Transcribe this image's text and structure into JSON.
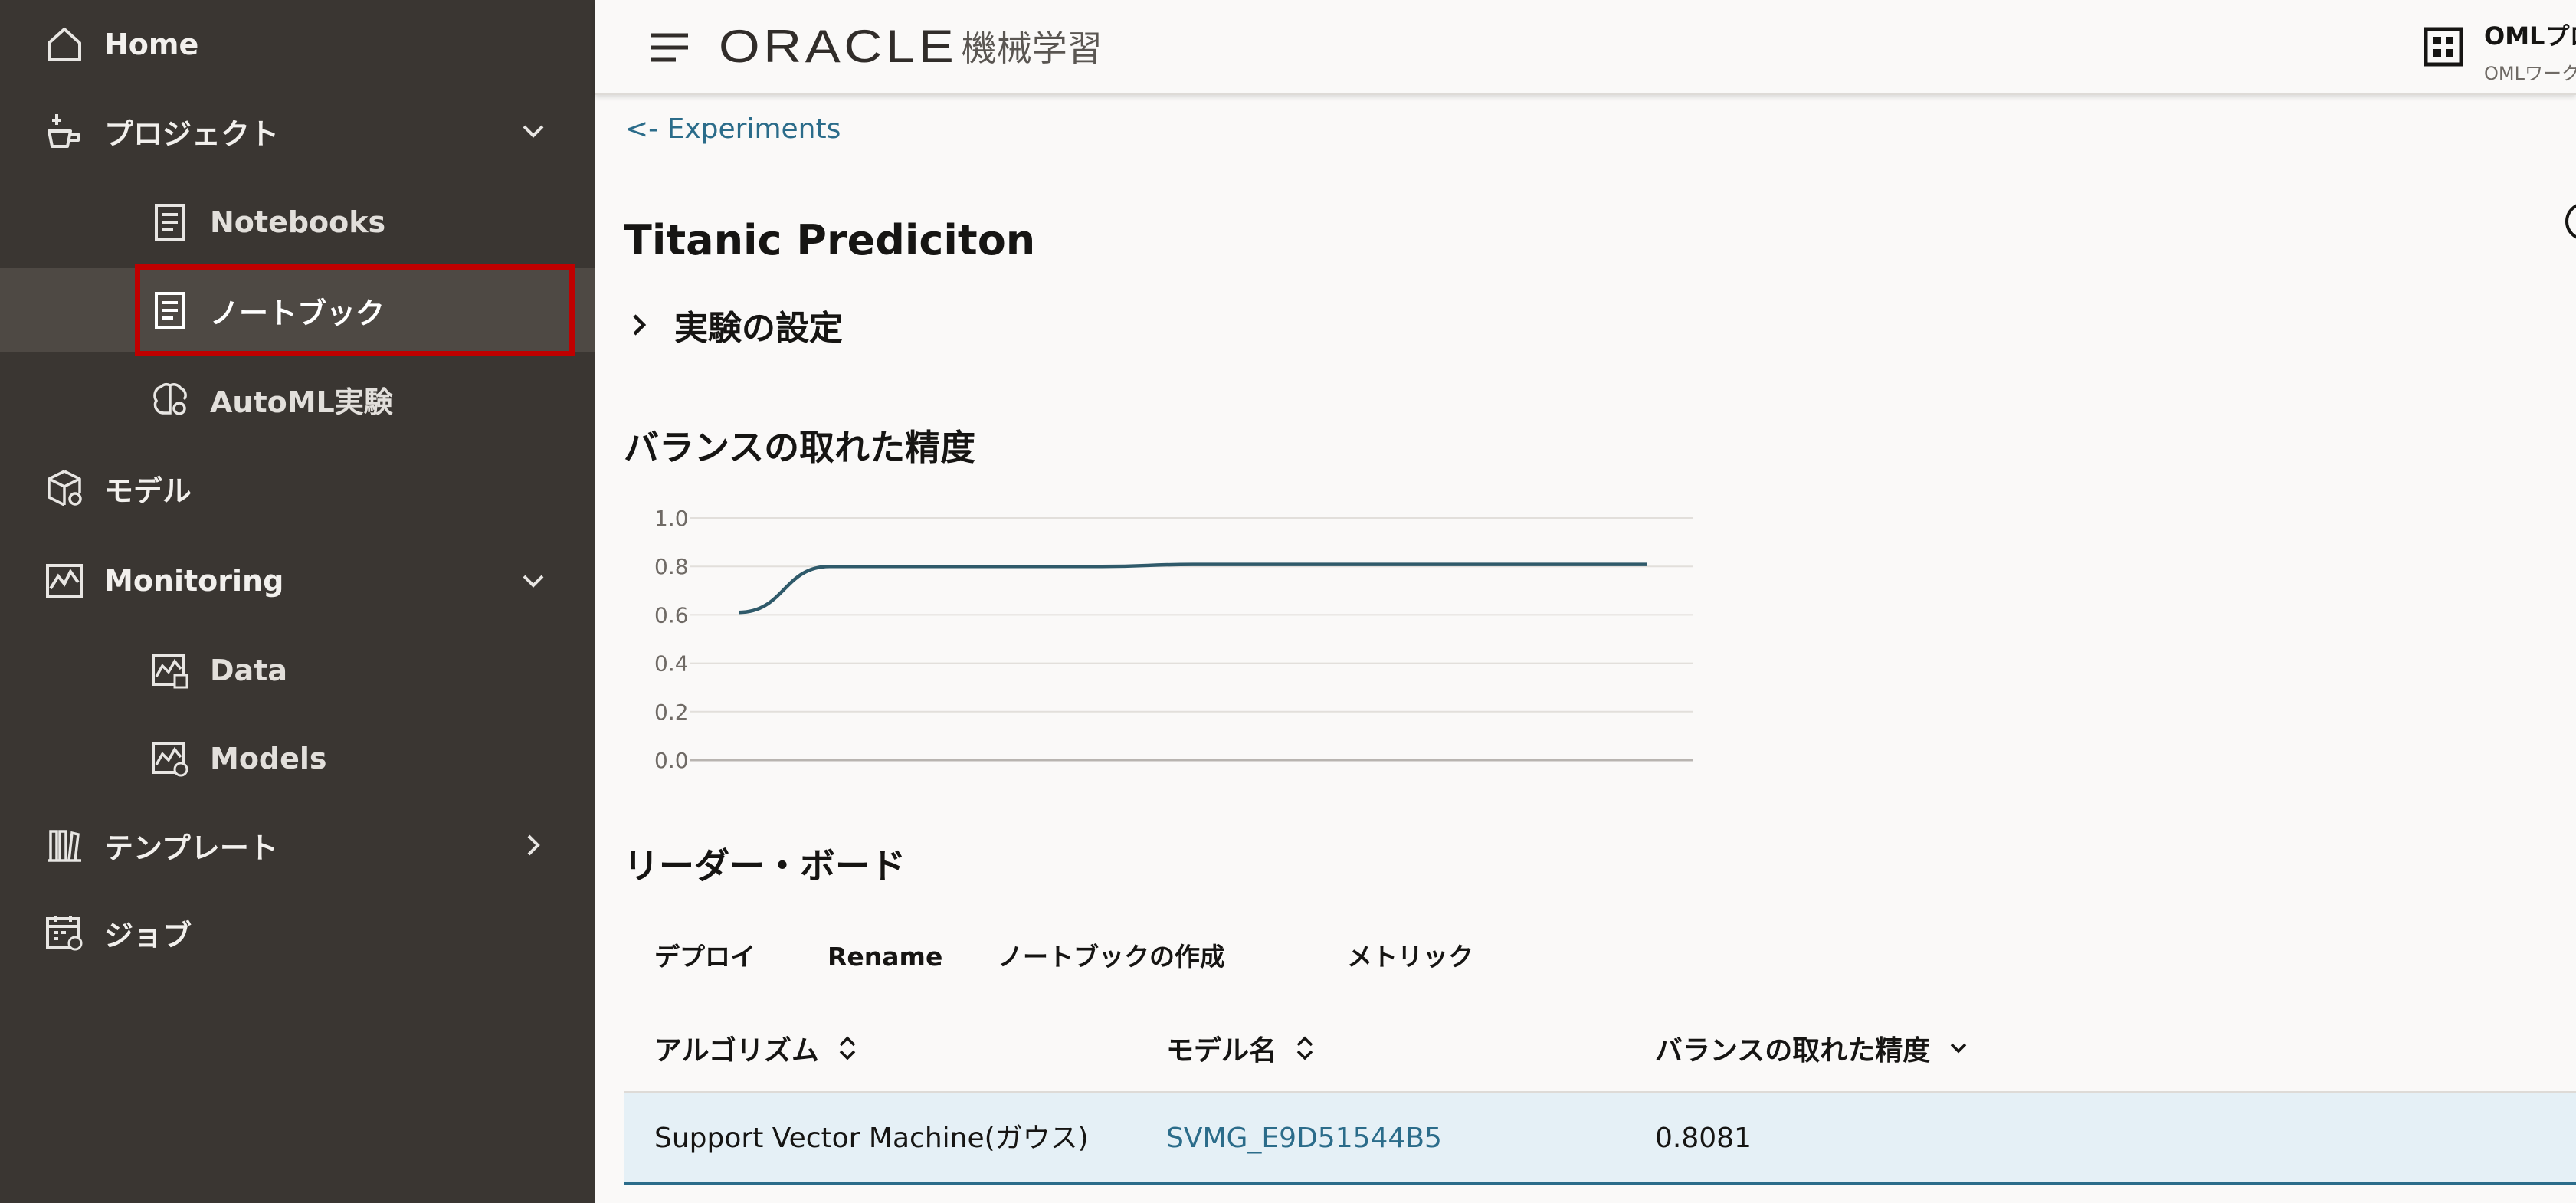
{
  "sidebar": {
    "items": [
      {
        "label": "Home",
        "icon": "home-icon"
      },
      {
        "label": "プロジェクト",
        "icon": "project-icon",
        "expanded": true
      },
      {
        "label": "Notebooks",
        "icon": "notebook-icon"
      },
      {
        "label": "ノートブック",
        "icon": "notebook-icon",
        "selected": true
      },
      {
        "label": "AutoML実験",
        "icon": "automl-icon"
      },
      {
        "label": "モデル",
        "icon": "model-icon"
      },
      {
        "label": "Monitoring",
        "icon": "monitoring-icon",
        "expanded": true
      },
      {
        "label": "Data",
        "icon": "data-monitor-icon"
      },
      {
        "label": "Models",
        "icon": "models-monitor-icon"
      },
      {
        "label": "テンプレート",
        "icon": "template-icon",
        "expanded": false
      },
      {
        "label": "ジョブ",
        "icon": "jobs-icon"
      }
    ],
    "highlight_color": "#c00000"
  },
  "header": {
    "brand": "ORACLE",
    "product": "機械学習",
    "workspace_name": "OMLプロ",
    "workspace_sub": "OMLワーク"
  },
  "main": {
    "back_link": "<- Experiments",
    "title": "Titanic Prediciton",
    "settings_label": "実験の設定",
    "chart_heading": "バランスの取れた精度",
    "leaderboard_heading": "リーダー・ボード",
    "toolbar": {
      "deploy": "デプロイ",
      "rename": "Rename",
      "create_notebook": "ノートブックの作成",
      "metrics": "メトリック"
    },
    "table": {
      "columns": [
        "アルゴリズム",
        "モデル名",
        "バランスの取れた精度"
      ],
      "rows": [
        [
          "Support Vector Machine(ガウス)",
          "SVMG_E9D51544B5",
          "0.8081"
        ]
      ]
    }
  },
  "chart_data": {
    "type": "line",
    "title": "",
    "xlabel": "",
    "ylabel": "",
    "ylim": [
      0,
      1
    ],
    "yticks": [
      "0.0",
      "0.2",
      "0.4",
      "0.6",
      "0.8",
      "1.0"
    ],
    "grid": true,
    "series": [
      {
        "color": "#2f5a6a",
        "x": [
          0,
          1,
          2,
          3,
          4,
          5,
          6,
          7,
          8,
          9,
          10
        ],
        "values": [
          0.61,
          0.8,
          0.8,
          0.8,
          0.8,
          0.808,
          0.808,
          0.808,
          0.808,
          0.808,
          0.808
        ]
      }
    ]
  },
  "colors": {
    "sidebar_bg": "#3a3632",
    "link": "#2b6c8a",
    "selected_row": "#e5f0f6"
  }
}
